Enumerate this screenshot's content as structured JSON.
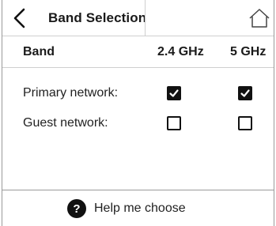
{
  "header": {
    "title": "Band Selection",
    "back_icon": "chevron-left-icon",
    "home_icon": "home-icon"
  },
  "table": {
    "columns": [
      "Band",
      "2.4 GHz",
      "5 GHz"
    ],
    "rows": [
      {
        "label": "Primary network:",
        "band_2_4": true,
        "band_5": true
      },
      {
        "label": "Guest network:",
        "band_2_4": false,
        "band_5": false
      }
    ]
  },
  "footer": {
    "help_icon": "?",
    "help_label": "Help me choose"
  }
}
